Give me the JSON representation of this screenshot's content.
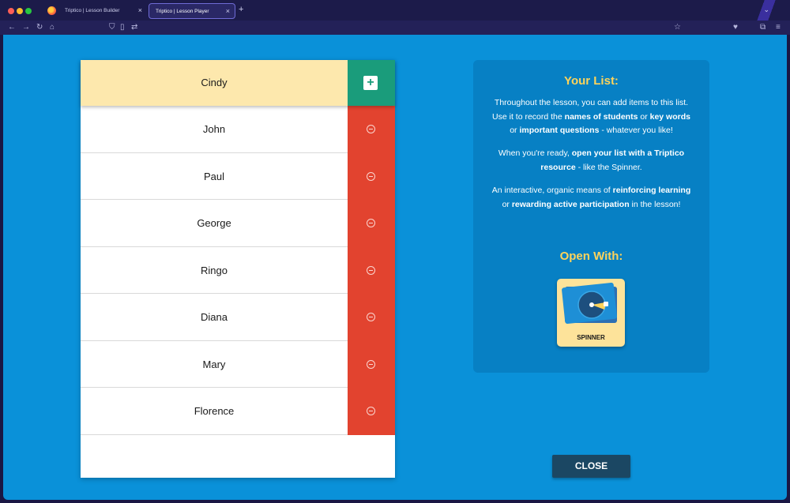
{
  "browser": {
    "tabs": [
      {
        "label": "Triptico | Lesson Builder",
        "close": "×"
      },
      {
        "label": "Triptico | Lesson Player",
        "close": "×"
      }
    ],
    "new_tab": "+",
    "menu_chevron": "⌄",
    "nav_icons": {
      "back": "←",
      "forward": "→",
      "reload": "↻",
      "home": "⌂",
      "shield": "⛉",
      "page": "▯",
      "swap": "⇄",
      "star": "☆",
      "pocket": "♥",
      "ext": "⧉",
      "menu": "≡"
    }
  },
  "list": {
    "current_input": "Cindy",
    "add_label": "+",
    "items": [
      "John",
      "Paul",
      "George",
      "Ringo",
      "Diana",
      "Mary",
      "Florence"
    ]
  },
  "info": {
    "title": "Your List:",
    "p1": {
      "a": "Throughout the lesson, you can add items to this list. Use it to record the ",
      "b1": "names of students",
      "c": " or ",
      "b2": "key words",
      "d": " or ",
      "b3": "important questions",
      "e": " - whatever you like!"
    },
    "p2": {
      "a": "When you're ready, ",
      "b1": "open your list with a Triptico resource",
      "c": " - like the Spinner."
    },
    "p3": {
      "a": "An interactive, organic means of ",
      "b1": "reinforcing learning",
      "c": " or ",
      "b2": "rewarding active participation",
      "d": " in the lesson!"
    },
    "open_with_title": "Open With:",
    "spinner_label": "SPINNER"
  },
  "close_label": "CLOSE",
  "colors": {
    "app_bg": "#0a91d9",
    "panel_bg": "#0780c4",
    "accent_yellow": "#fdd35b",
    "add_green": "#1a9c7b",
    "delete_red": "#e2432f",
    "input_row": "#fde8ad",
    "close_btn": "#1b4763"
  }
}
